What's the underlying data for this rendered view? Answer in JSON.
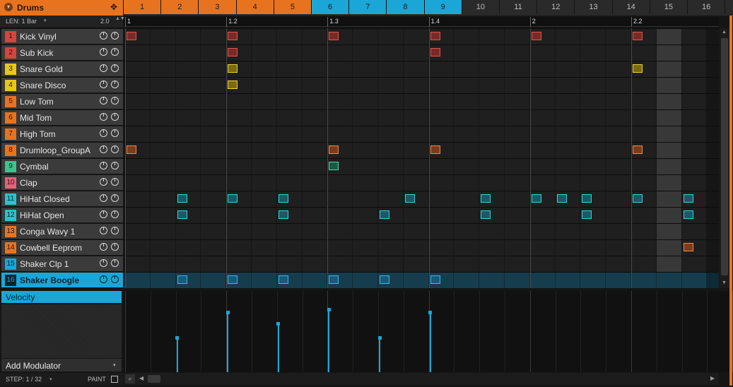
{
  "group": {
    "name": "Drums",
    "caret_icon": "▾",
    "move_icon": "✥",
    "color": "#e8731f"
  },
  "patterns": [
    {
      "label": "1",
      "on": true,
      "color": "#e8731f"
    },
    {
      "label": "2",
      "on": true,
      "color": "#e8731f"
    },
    {
      "label": "3",
      "on": true,
      "color": "#e8731f"
    },
    {
      "label": "4",
      "on": true,
      "color": "#e8731f"
    },
    {
      "label": "5",
      "on": true,
      "color": "#e8731f"
    },
    {
      "label": "6",
      "on": true,
      "color": "#1aa7d8"
    },
    {
      "label": "7",
      "on": true,
      "color": "#1aa7d8"
    },
    {
      "label": "8",
      "on": true,
      "color": "#1aa7d8"
    },
    {
      "label": "9",
      "on": true,
      "color": "#1aa7d8"
    },
    {
      "label": "10",
      "on": false,
      "color": "#2a2a2a"
    },
    {
      "label": "11",
      "on": false,
      "color": "#2a2a2a"
    },
    {
      "label": "12",
      "on": false,
      "color": "#2a2a2a"
    },
    {
      "label": "13",
      "on": false,
      "color": "#2a2a2a"
    },
    {
      "label": "14",
      "on": false,
      "color": "#2a2a2a"
    },
    {
      "label": "15",
      "on": false,
      "color": "#2a2a2a"
    },
    {
      "label": "16",
      "on": false,
      "color": "#2a2a2a"
    }
  ],
  "length": {
    "label": "LEN: 1 Bar",
    "caret": "▾",
    "zoom": "2.0",
    "arrows": "▲▼"
  },
  "ruler": {
    "labels": [
      "1",
      "1.2",
      "1.3",
      "1.4",
      "2",
      "2.2"
    ]
  },
  "sounds": [
    {
      "num": "1",
      "name": "Kick Vinyl",
      "color": "#d6453b"
    },
    {
      "num": "2",
      "name": "Sub Kick",
      "color": "#d6453b"
    },
    {
      "num": "3",
      "name": "Snare Gold",
      "color": "#e8c61a"
    },
    {
      "num": "4",
      "name": "Snare Disco",
      "color": "#e8c61a"
    },
    {
      "num": "5",
      "name": "Low Tom",
      "color": "#e8731f"
    },
    {
      "num": "6",
      "name": "Mid Tom",
      "color": "#e8731f"
    },
    {
      "num": "7",
      "name": "High Tom",
      "color": "#e8731f"
    },
    {
      "num": "8",
      "name": "Drumloop_GroupA",
      "color": "#e8731f"
    },
    {
      "num": "9",
      "name": "Cymbal",
      "color": "#3ec38c"
    },
    {
      "num": "10",
      "name": "Clap",
      "color": "#e8607a"
    },
    {
      "num": "11",
      "name": "HiHat Closed",
      "color": "#27c4cf"
    },
    {
      "num": "12",
      "name": "HiHat Open",
      "color": "#27c4cf"
    },
    {
      "num": "13",
      "name": "Conga Wavy 1",
      "color": "#e8731f"
    },
    {
      "num": "14",
      "name": "Cowbell Eeprom",
      "color": "#e8731f"
    },
    {
      "num": "15",
      "name": "Shaker Clp 1",
      "color": "#1aa7d8"
    },
    {
      "num": "16",
      "name": "Shaker Boogle",
      "color": "#1aa7d8",
      "selected": true
    }
  ],
  "steps_visible": 23,
  "notes": [
    {
      "row": 0,
      "steps": [
        0,
        4,
        8,
        12,
        16,
        20
      ],
      "fill": "#7a2a26",
      "border": "#e0574e"
    },
    {
      "row": 1,
      "steps": [
        4,
        12
      ],
      "fill": "#7a2a26",
      "border": "#e0574e"
    },
    {
      "row": 2,
      "steps": [
        4,
        20
      ],
      "fill": "#7a6a10",
      "border": "#f0d23a"
    },
    {
      "row": 3,
      "steps": [
        4
      ],
      "fill": "#7a6a10",
      "border": "#f0d23a"
    },
    {
      "row": 7,
      "steps": [
        0,
        8,
        12,
        20
      ],
      "fill": "#7a3c1a",
      "border": "#f08a4a"
    },
    {
      "row": 8,
      "steps": [
        8
      ],
      "fill": "#1a5a44",
      "border": "#4ed8a4"
    },
    {
      "row": 10,
      "steps": [
        2,
        4,
        6,
        11,
        14,
        16,
        17,
        18,
        20,
        22
      ],
      "fill": "#1a5a66",
      "border": "#3ad0de"
    },
    {
      "row": 11,
      "steps": [
        2,
        6,
        10,
        14,
        18,
        22
      ],
      "fill": "#1a5a66",
      "border": "#3ad0de"
    },
    {
      "row": 13,
      "steps": [
        22
      ],
      "fill": "#7a3c1a",
      "border": "#f08a4a"
    },
    {
      "row": 15,
      "steps": [
        2,
        4,
        6,
        8,
        10,
        12
      ],
      "fill": "#1a5a7a",
      "border": "#3ab8e8"
    }
  ],
  "velocity": {
    "tab_label": "Velocity",
    "add_modulator_label": "Add Modulator",
    "add_modulator_caret": "▾",
    "values": [
      {
        "step": 2,
        "value": 0.45
      },
      {
        "step": 4,
        "value": 0.78
      },
      {
        "step": 6,
        "value": 0.63
      },
      {
        "step": 8,
        "value": 0.82
      },
      {
        "step": 10,
        "value": 0.45
      },
      {
        "step": 12,
        "value": 0.78
      }
    ]
  },
  "status": {
    "step_label": "STEP: 1 / 32",
    "step_caret": "▾",
    "paint_label": "PAINT"
  },
  "scroll": {
    "zoom_icon": "⌕",
    "left_icon": "◀",
    "right_icon": "▶",
    "up_icon": "▲",
    "down_icon": "▼"
  }
}
